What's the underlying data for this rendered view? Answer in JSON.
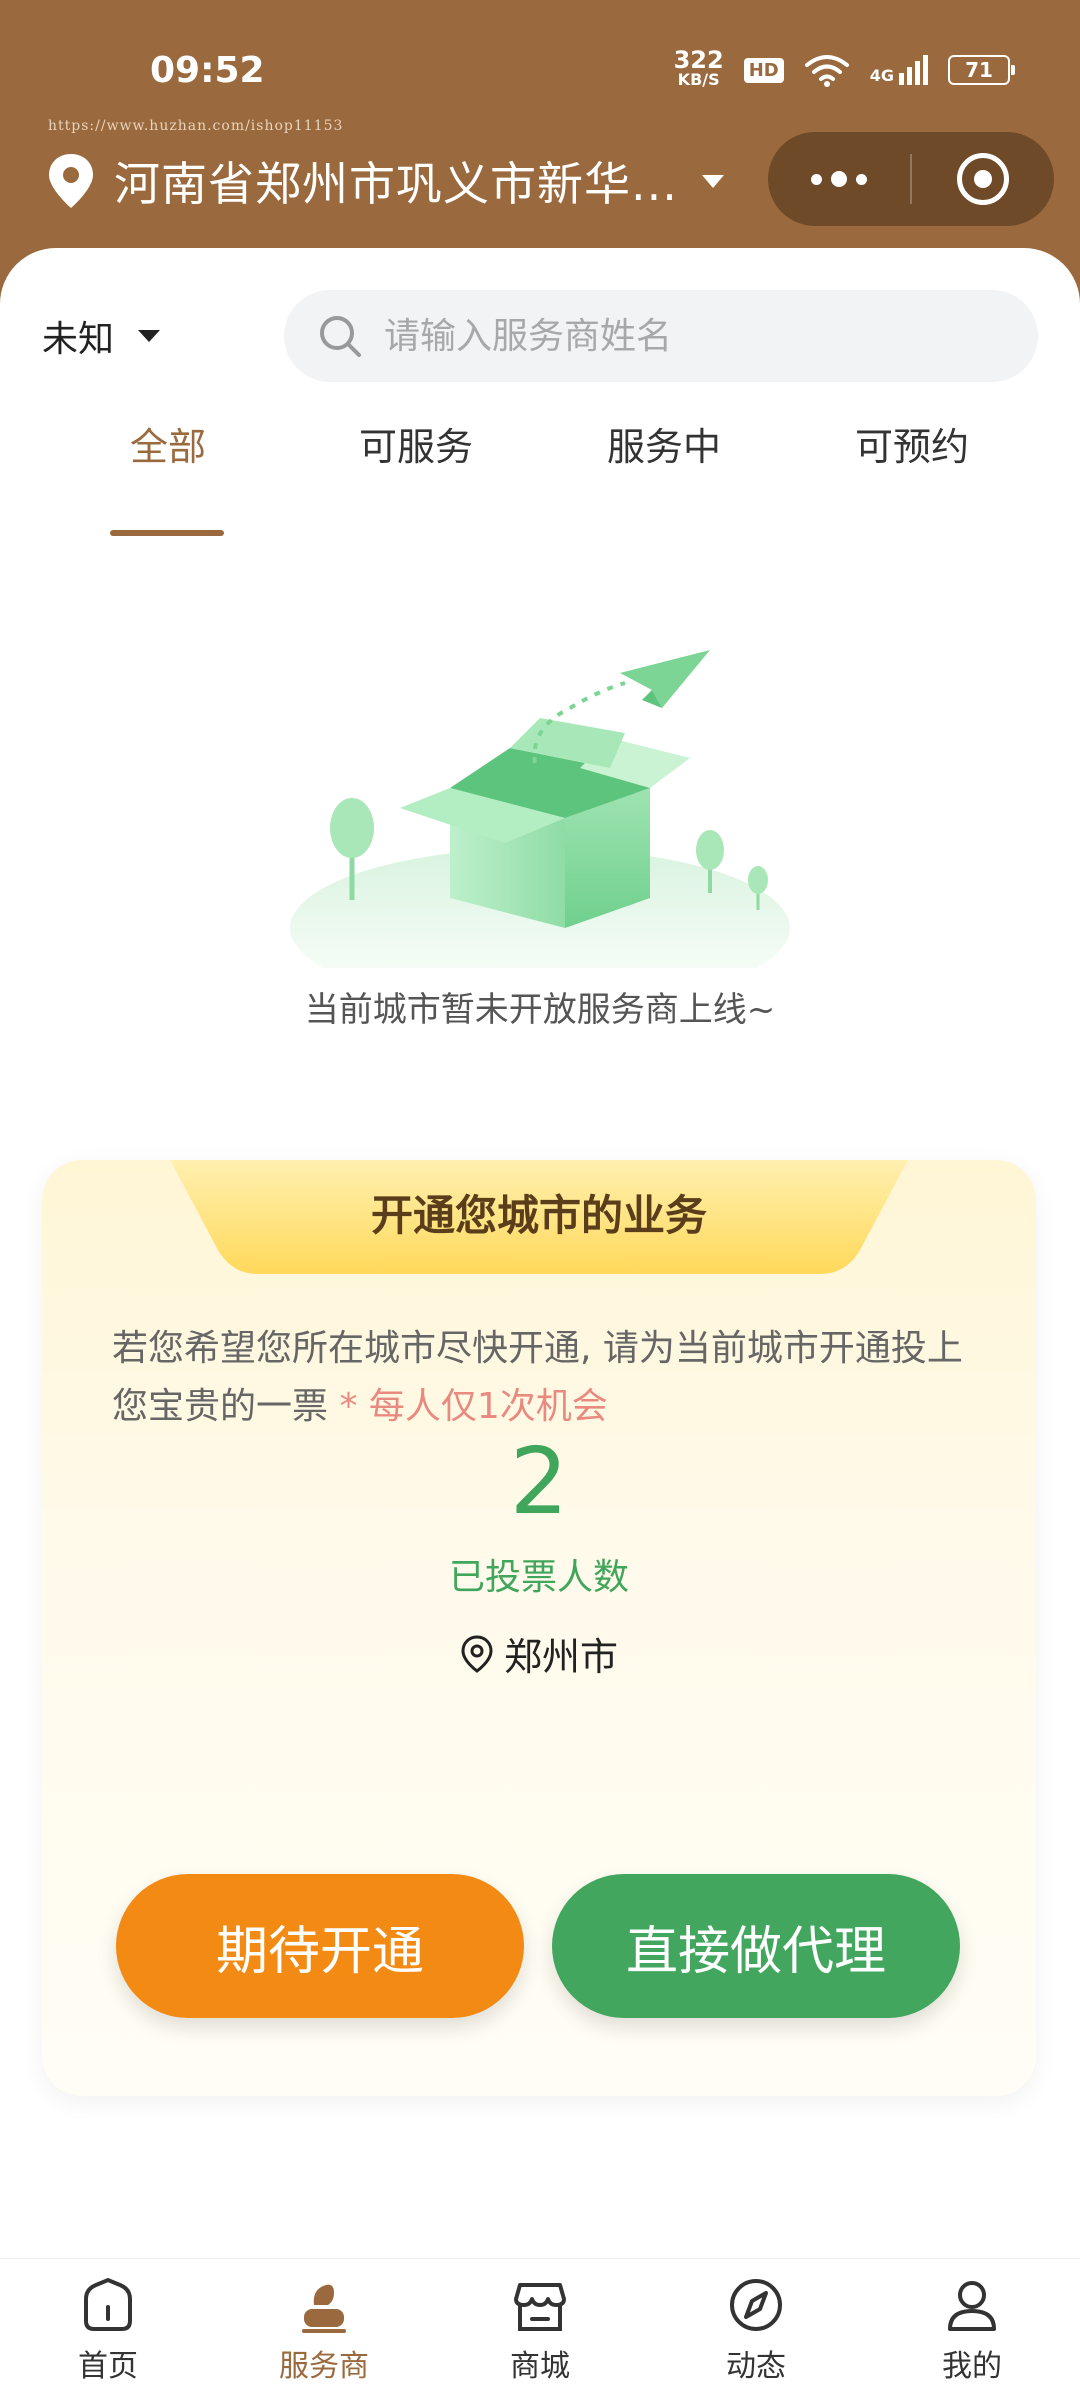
{
  "status_bar": {
    "time": "09:52",
    "net_speed": "322",
    "net_unit": "KB/S",
    "hd": "HD",
    "signal_label": "4G",
    "battery": "71"
  },
  "watermark": "https://www.huzhan.com/ishop11153",
  "header": {
    "location": "河南省郑州市巩义市新华...",
    "location_icon": "map-pin-icon",
    "menu_icon": "more-dots-icon",
    "close_icon": "target-close-icon"
  },
  "filter": {
    "label": "未知",
    "search_placeholder": "请输入服务商姓名"
  },
  "tabs": [
    {
      "label": "全部",
      "active": true
    },
    {
      "label": "可服务",
      "active": false
    },
    {
      "label": "服务中",
      "active": false
    },
    {
      "label": "可预约",
      "active": false
    }
  ],
  "empty_state": {
    "text": "当前城市暂未开放服务商上线~"
  },
  "card": {
    "title": "开通您城市的业务",
    "desc": "若您希望您所在城市尽快开通, 请为当前城市开通投上您宝贵的一票",
    "desc_highlight": " * 每人仅1次机会",
    "vote_count": "2",
    "vote_label": "已投票人数",
    "city": "郑州市",
    "btn_expect": "期待开通",
    "btn_agent": "直接做代理"
  },
  "colors": {
    "brand": "#9a6a3e",
    "green": "#42a65f",
    "orange": "#f28a14"
  },
  "nav": [
    {
      "label": "首页",
      "icon": "home-icon",
      "active": false
    },
    {
      "label": "服务商",
      "icon": "provider-icon",
      "active": true
    },
    {
      "label": "商城",
      "icon": "shop-icon",
      "active": false
    },
    {
      "label": "动态",
      "icon": "compass-icon",
      "active": false
    },
    {
      "label": "我的",
      "icon": "user-icon",
      "active": false
    }
  ]
}
